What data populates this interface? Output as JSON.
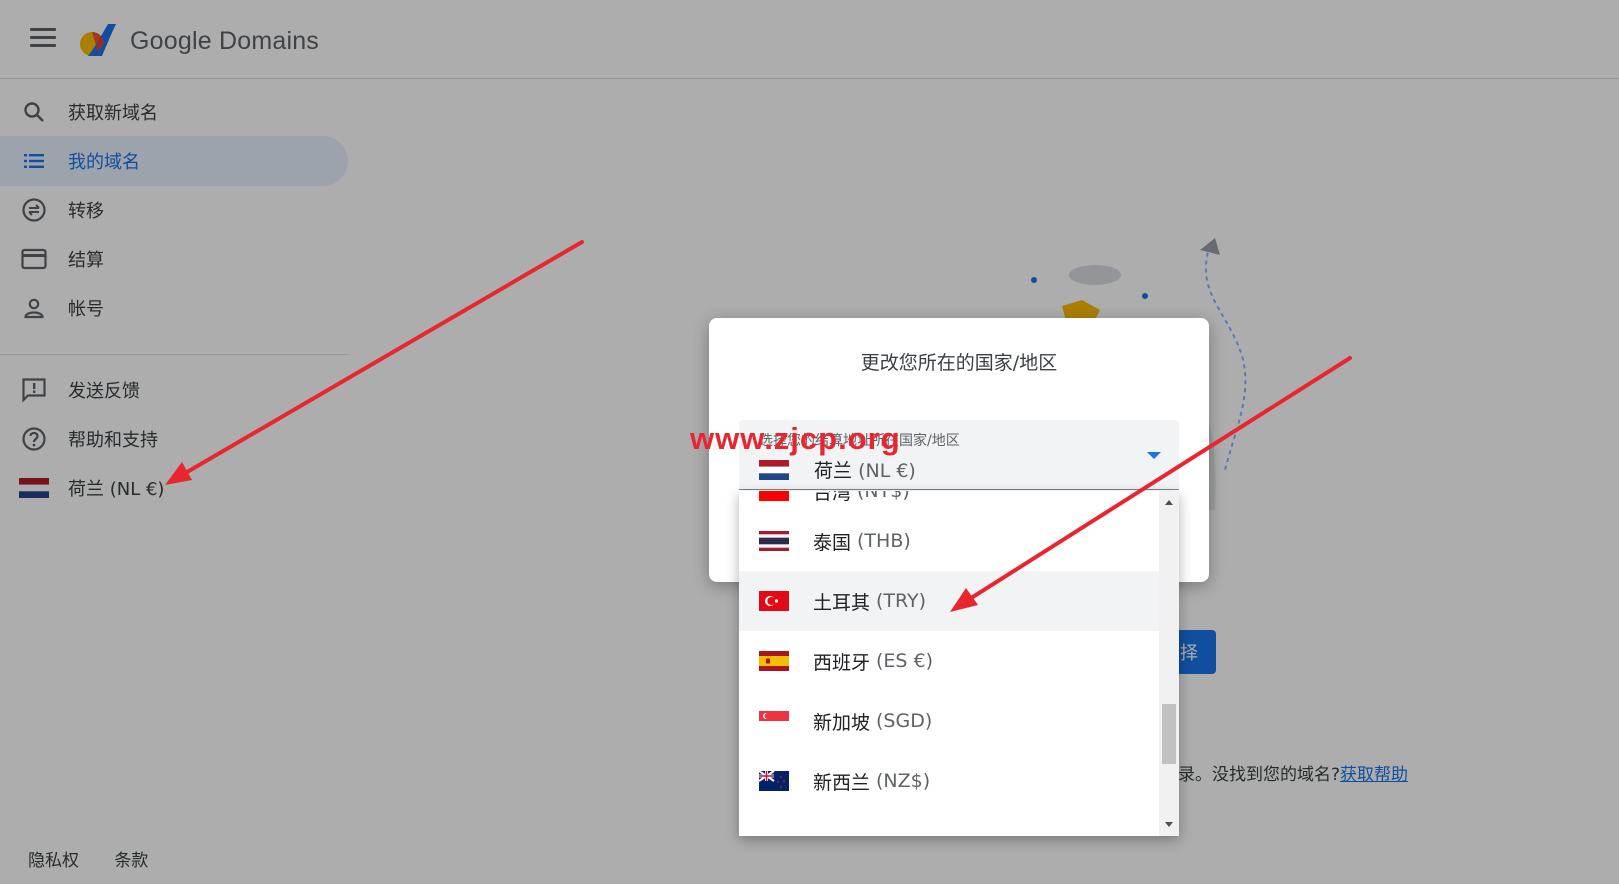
{
  "header": {
    "brand": "Google Domains"
  },
  "sidebar": {
    "items": [
      {
        "label": "获取新域名",
        "icon": "search-icon"
      },
      {
        "label": "我的域名",
        "icon": "list-icon",
        "active": true
      },
      {
        "label": "转移",
        "icon": "transfer-icon"
      },
      {
        "label": "结算",
        "icon": "credit-card-icon"
      },
      {
        "label": "帐号",
        "icon": "account-icon"
      }
    ],
    "secondary": [
      {
        "label": "发送反馈",
        "icon": "feedback-icon"
      },
      {
        "label": "帮助和支持",
        "icon": "help-icon"
      },
      {
        "label": "荷兰 (NL €)",
        "icon": "netherlands-flag-icon"
      }
    ],
    "footer": {
      "privacy": "隐私权",
      "terms": "条款"
    }
  },
  "main": {
    "button_label": "择",
    "help_text": "录。没找到您的域名?",
    "help_link": "获取帮助"
  },
  "dialog": {
    "title": "更改您所在的国家/地区",
    "select_label": "选择您的结算地址所在国家/地区",
    "selected": {
      "name": "荷兰",
      "code": "(NL €)",
      "flag": "netherlands-flag-icon"
    }
  },
  "dropdown": {
    "partial": {
      "name": "台湾",
      "code": "(NT$)"
    },
    "items": [
      {
        "name": "泰国",
        "code": "(THB)",
        "flag": "thailand-flag-icon"
      },
      {
        "name": "土耳其",
        "code": "(TRY)",
        "flag": "turkey-flag-icon",
        "hover": true
      },
      {
        "name": "西班牙",
        "code": "(ES €)",
        "flag": "spain-flag-icon"
      },
      {
        "name": "新加坡",
        "code": "(SGD)",
        "flag": "singapore-flag-icon"
      },
      {
        "name": "新西兰",
        "code": "(NZ$)",
        "flag": "new-zealand-flag-icon"
      }
    ]
  },
  "watermark": "www.zjcp.org",
  "colors": {
    "accent": "#1a73e8",
    "arrow": "#e8262f",
    "hover": "#f1f3f4"
  }
}
